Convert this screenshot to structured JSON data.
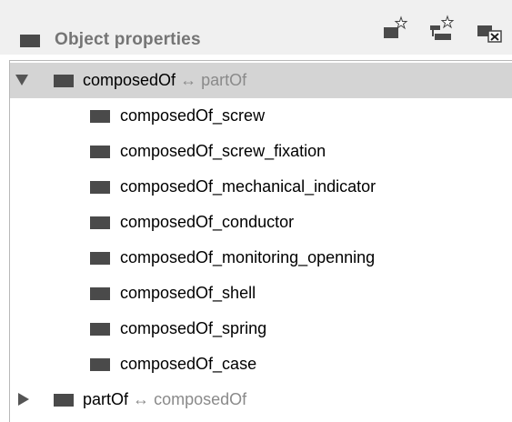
{
  "header": {
    "title": "Object properties",
    "tools": {
      "add_subproperty": "add-subproperty-icon",
      "add_sibling": "add-sibling-property-icon",
      "delete": "delete-property-icon"
    }
  },
  "tree": {
    "root1": {
      "label": "composedOf",
      "arrow": "↔",
      "inverse": "partOf",
      "expanded": true,
      "children": [
        "composedOf_screw",
        "composedOf_screw_fixation",
        "composedOf_mechanical_indicator",
        "composedOf_conductor",
        "composedOf_monitoring_openning",
        "composedOf_shell",
        "composedOf_spring",
        "composedOf_case"
      ]
    },
    "root2": {
      "label": "partOf",
      "arrow": "↔",
      "inverse": "composedOf",
      "expanded": false
    }
  },
  "colors": {
    "selected_row": "#d4d4d4",
    "icon": "#4a4a4a",
    "title": "#757575",
    "inverse_text": "#8a8a8a"
  }
}
